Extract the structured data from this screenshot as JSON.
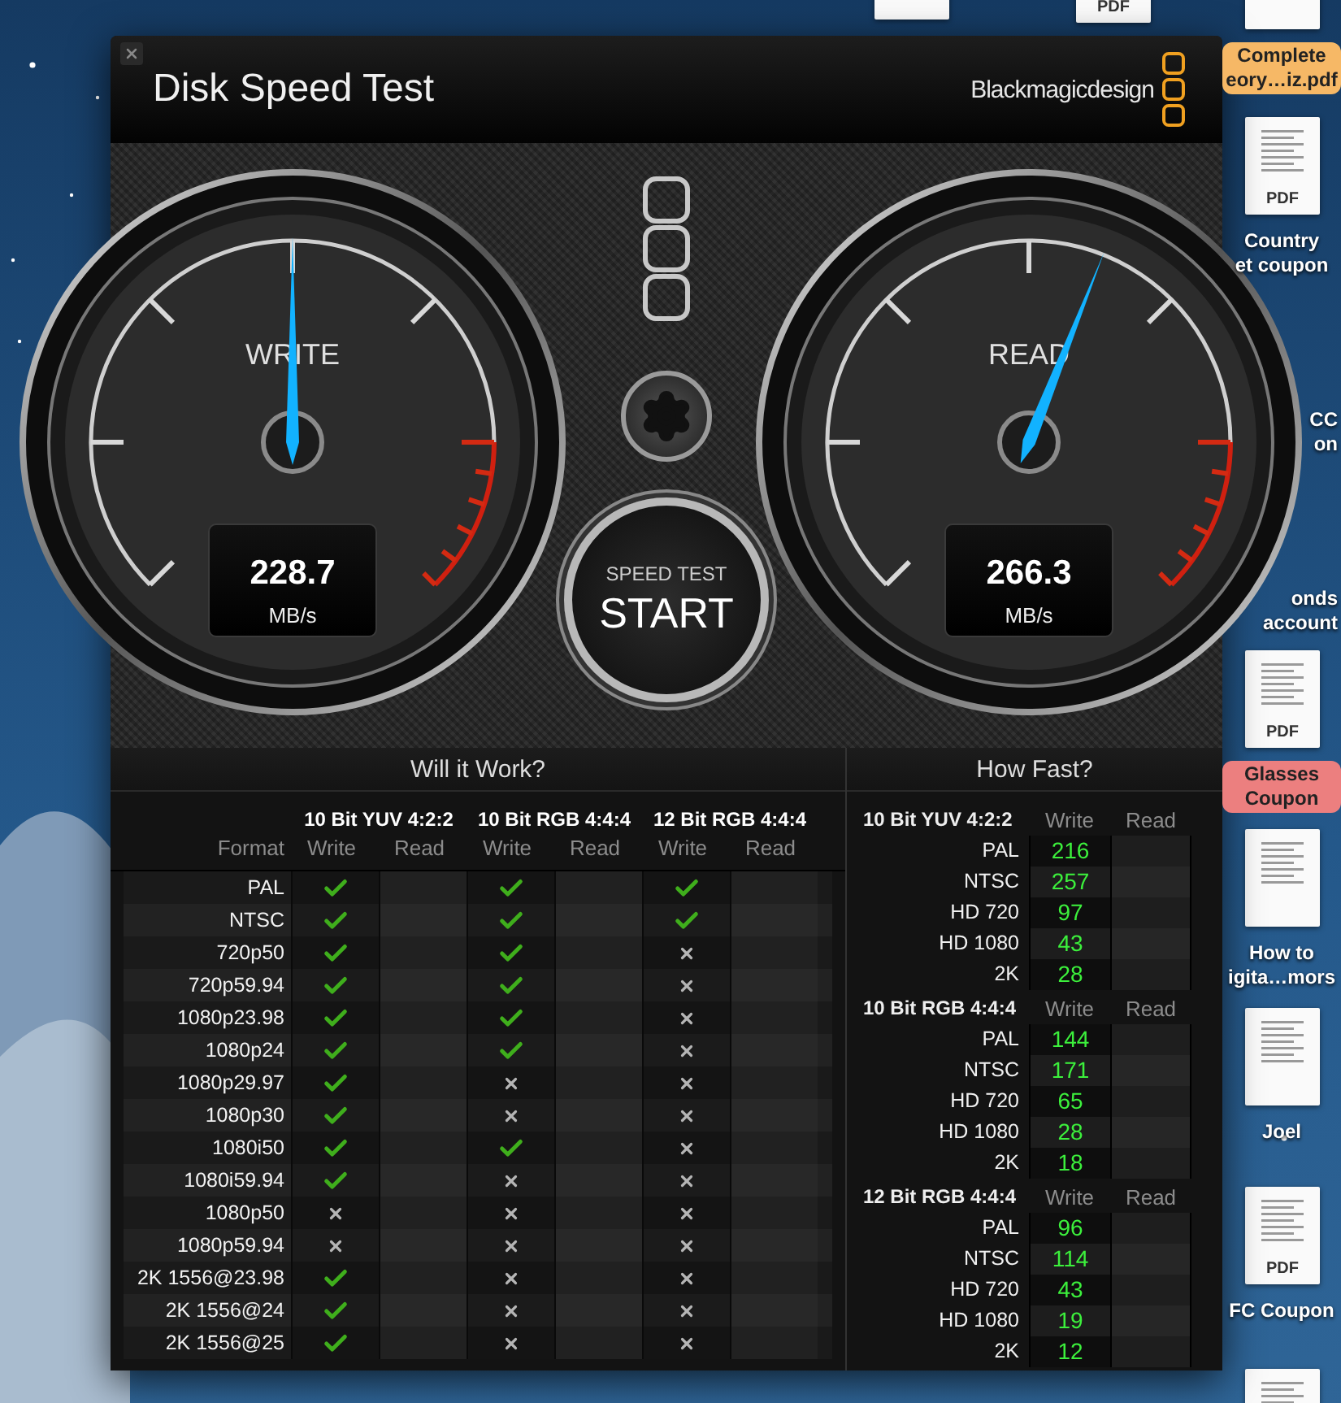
{
  "window": {
    "title": "Disk Speed Test",
    "brand": "Blackmagicdesign"
  },
  "gauges": [
    {
      "label": "WRITE",
      "value": "228.7",
      "unit": "MB/s",
      "level": 0.5
    },
    {
      "label": "READ",
      "value": "266.3",
      "unit": "MB/s",
      "level": 0.58
    }
  ],
  "start_button": {
    "caption": "SPEED TEST",
    "label": "START"
  },
  "will_it_work": {
    "title": "Will it Work?",
    "format_header": "Format",
    "groups": [
      {
        "name": "10 Bit YUV 4:2:2",
        "write": "Write",
        "read": "Read"
      },
      {
        "name": "10 Bit RGB 4:4:4",
        "write": "Write",
        "read": "Read"
      },
      {
        "name": "12 Bit RGB 4:4:4",
        "write": "Write",
        "read": "Read"
      }
    ],
    "rows": [
      {
        "format": "PAL",
        "works": [
          true,
          true,
          true
        ]
      },
      {
        "format": "NTSC",
        "works": [
          true,
          true,
          true
        ]
      },
      {
        "format": "720p50",
        "works": [
          true,
          true,
          false
        ]
      },
      {
        "format": "720p59.94",
        "works": [
          true,
          true,
          false
        ]
      },
      {
        "format": "1080p23.98",
        "works": [
          true,
          true,
          false
        ]
      },
      {
        "format": "1080p24",
        "works": [
          true,
          true,
          false
        ]
      },
      {
        "format": "1080p29.97",
        "works": [
          true,
          false,
          false
        ]
      },
      {
        "format": "1080p30",
        "works": [
          true,
          false,
          false
        ]
      },
      {
        "format": "1080i50",
        "works": [
          true,
          true,
          false
        ]
      },
      {
        "format": "1080i59.94",
        "works": [
          true,
          false,
          false
        ]
      },
      {
        "format": "1080p50",
        "works": [
          false,
          false,
          false
        ]
      },
      {
        "format": "1080p59.94",
        "works": [
          false,
          false,
          false
        ]
      },
      {
        "format": "2K 1556@23.98",
        "works": [
          true,
          false,
          false
        ]
      },
      {
        "format": "2K 1556@24",
        "works": [
          true,
          false,
          false
        ]
      },
      {
        "format": "2K 1556@25",
        "works": [
          true,
          false,
          false
        ]
      }
    ]
  },
  "how_fast": {
    "title": "How Fast?",
    "groups": [
      {
        "name": "10 Bit YUV 4:2:2",
        "write": "Write",
        "read": "Read",
        "rows": [
          {
            "format": "PAL",
            "write": "216"
          },
          {
            "format": "NTSC",
            "write": "257"
          },
          {
            "format": "HD 720",
            "write": "97"
          },
          {
            "format": "HD 1080",
            "write": "43"
          },
          {
            "format": "2K",
            "write": "28"
          }
        ]
      },
      {
        "name": "10 Bit RGB 4:4:4",
        "write": "Write",
        "read": "Read",
        "rows": [
          {
            "format": "PAL",
            "write": "144"
          },
          {
            "format": "NTSC",
            "write": "171"
          },
          {
            "format": "HD 720",
            "write": "65"
          },
          {
            "format": "HD 1080",
            "write": "28"
          },
          {
            "format": "2K",
            "write": "18"
          }
        ]
      },
      {
        "name": "12 Bit RGB 4:4:4",
        "write": "Write",
        "read": "Read",
        "rows": [
          {
            "format": "PAL",
            "write": "96"
          },
          {
            "format": "NTSC",
            "write": "114"
          },
          {
            "format": "HD 720",
            "write": "43"
          },
          {
            "format": "HD 1080",
            "write": "19"
          },
          {
            "format": "2K",
            "write": "12"
          }
        ]
      }
    ]
  },
  "desktop_icons": [
    {
      "kind": "document"
    },
    {
      "kind": "pdf",
      "badge": "PDF"
    },
    {
      "kind": "document",
      "label": "Complete\neory…iz.pdf",
      "color": "#f6b866"
    },
    {
      "kind": "pdf",
      "badge": "PDF",
      "label": "Country\net coupon"
    },
    {
      "kind": "label-only",
      "label": "CC\non"
    },
    {
      "kind": "label-only",
      "label": "onds\naccount"
    },
    {
      "kind": "pdf",
      "badge": "PDF",
      "label": "Glasses\nCoupon",
      "color": "#ec7f7f"
    },
    {
      "kind": "document",
      "label": "How to\nigita…mors"
    },
    {
      "kind": "document",
      "label": "Joel"
    },
    {
      "kind": "pdf",
      "badge": "PDF",
      "label": "FC Coupon"
    },
    {
      "kind": "document"
    }
  ]
}
